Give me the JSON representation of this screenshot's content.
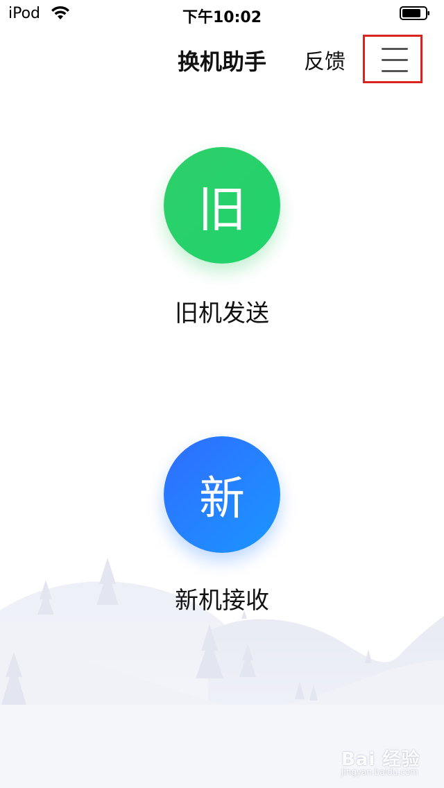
{
  "status_bar": {
    "carrier": "iPod",
    "time": "下午10:02",
    "icons": [
      "wifi-icon",
      "battery-icon"
    ]
  },
  "nav": {
    "title": "换机助手",
    "feedback_label": "反馈",
    "menu_icon": "hamburger-menu-icon",
    "highlight_color": "#d9241d"
  },
  "actions": [
    {
      "glyph": "旧",
      "label": "旧机发送",
      "color": "#22d068"
    },
    {
      "glyph": "新",
      "label": "新机接收",
      "color": "#2a7bff"
    }
  ],
  "watermark": {
    "text": "Bai 经验",
    "sub": "jingyan.baidu.com"
  }
}
